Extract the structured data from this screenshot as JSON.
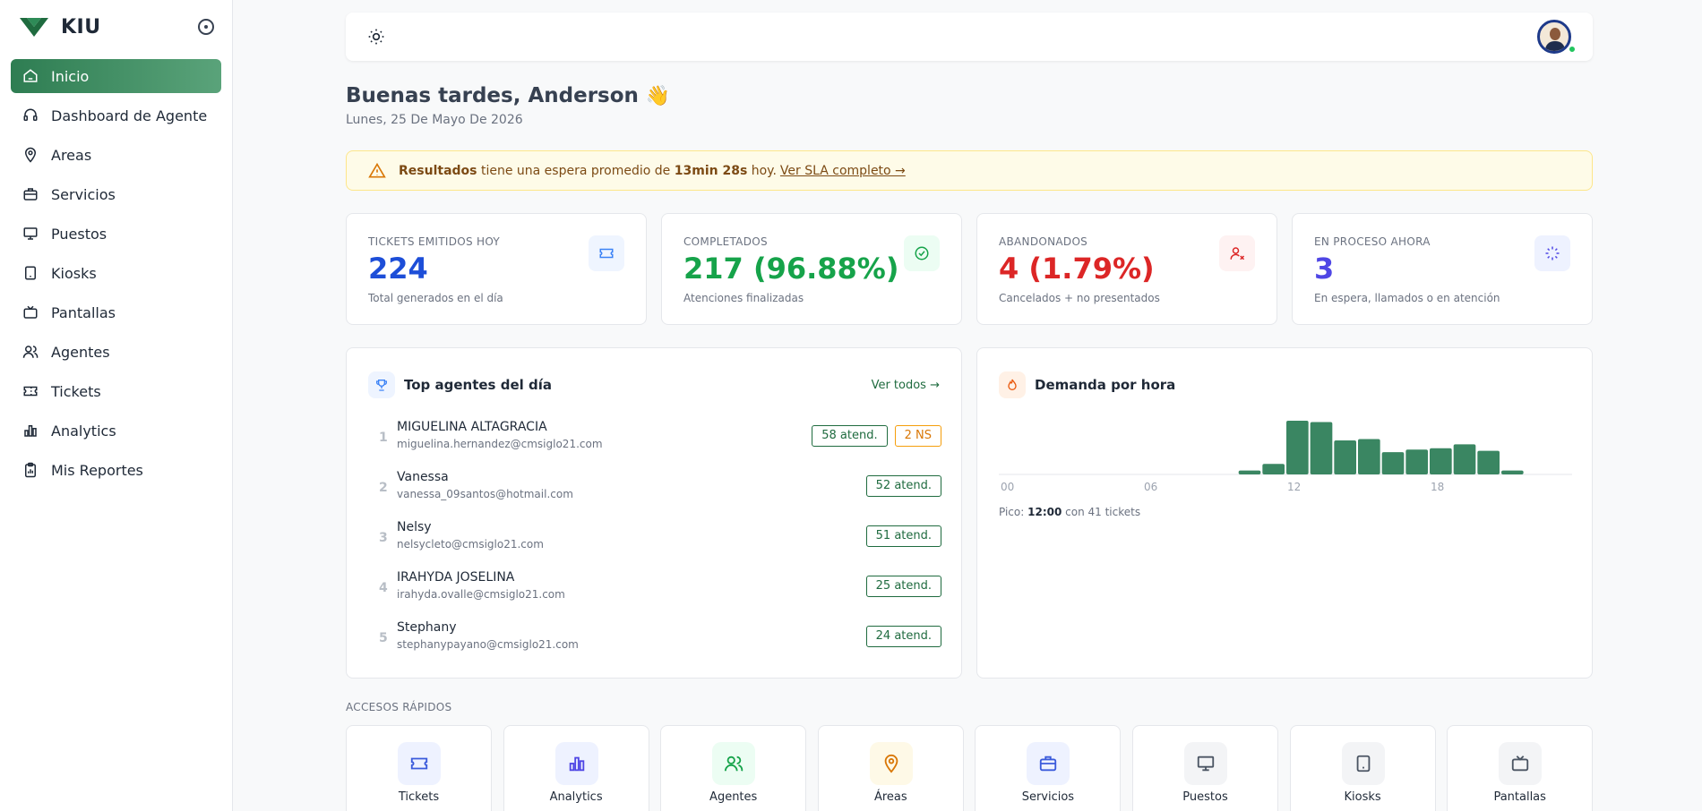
{
  "brand": {
    "name": "KIU"
  },
  "sidebar": {
    "items": [
      {
        "label": "Inicio",
        "icon": "home-icon",
        "active": true
      },
      {
        "label": "Dashboard de Agente",
        "icon": "headset-icon"
      },
      {
        "label": "Areas",
        "icon": "map-pin-icon"
      },
      {
        "label": "Servicios",
        "icon": "briefcase-icon"
      },
      {
        "label": "Puestos",
        "icon": "monitor-icon"
      },
      {
        "label": "Kiosks",
        "icon": "tablet-icon"
      },
      {
        "label": "Pantallas",
        "icon": "tv-icon"
      },
      {
        "label": "Agentes",
        "icon": "users-icon"
      },
      {
        "label": "Tickets",
        "icon": "ticket-icon"
      },
      {
        "label": "Analytics",
        "icon": "bar-chart-icon"
      },
      {
        "label": "Mis Reportes",
        "icon": "clipboard-icon"
      }
    ]
  },
  "header": {
    "greeting": "Buenas tardes, Anderson",
    "wave": "👋",
    "date": "Lunes, 25 De Mayo De 2026"
  },
  "alert": {
    "prefix": "Resultados",
    "middle": "tiene una espera promedio de",
    "time": "13min 28s",
    "suffix": "hoy.",
    "link": "Ver SLA completo →"
  },
  "stats": [
    {
      "label": "TICKETS EMITIDOS HOY",
      "value": "224",
      "sub": "Total generados en el día",
      "color": "#1d4ed8",
      "icon": "ticket-icon"
    },
    {
      "label": "COMPLETADOS",
      "value": "217 (96.88%)",
      "sub": "Atenciones finalizadas",
      "color": "#16a34a",
      "icon": "check-circle-icon"
    },
    {
      "label": "ABANDONADOS",
      "value": "4 (1.79%)",
      "sub": "Cancelados + no presentados",
      "color": "#dc2626",
      "icon": "user-x-icon"
    },
    {
      "label": "EN PROCESO AHORA",
      "value": "3",
      "sub": "En espera, llamados o en atención",
      "color": "#4f46e5",
      "icon": "loader-icon"
    }
  ],
  "top_agents": {
    "title": "Top agentes del día",
    "more": "Ver todos",
    "rows": [
      {
        "rank": "1",
        "name": "MIGUELINA ALTAGRACIA",
        "email": "miguelina.hernandez@cmsiglo21.com",
        "attended": "58 atend.",
        "ns": "2 NS"
      },
      {
        "rank": "2",
        "name": "Vanessa",
        "email": "vanessa_09santos@hotmail.com",
        "attended": "52 atend."
      },
      {
        "rank": "3",
        "name": "Nelsy",
        "email": "nelsycleto@cmsiglo21.com",
        "attended": "51 atend."
      },
      {
        "rank": "4",
        "name": "IRAHYDA JOSELINA",
        "email": "irahyda.ovalle@cmsiglo21.com",
        "attended": "25 atend."
      },
      {
        "rank": "5",
        "name": "Stephany",
        "email": "stephanypayano@cmsiglo21.com",
        "attended": "24 atend."
      }
    ]
  },
  "demand": {
    "title": "Demanda por hora",
    "peak_prefix": "Pico:",
    "peak_hour": "12:00",
    "peak_suffix": "con 41 tickets"
  },
  "chart_data": {
    "type": "bar",
    "categories": [
      "00",
      "01",
      "02",
      "03",
      "04",
      "05",
      "06",
      "07",
      "08",
      "09",
      "10",
      "11",
      "12",
      "13",
      "14",
      "15",
      "16",
      "17",
      "18",
      "19",
      "20",
      "21",
      "22",
      "23"
    ],
    "values": [
      0,
      0,
      0,
      0,
      0,
      0,
      0,
      0,
      0,
      0,
      3,
      8,
      41,
      40,
      26,
      27,
      17,
      19,
      20,
      23,
      18,
      3,
      0,
      0
    ],
    "tick_labels": [
      "00",
      "06",
      "12",
      "18"
    ],
    "title": "Demanda por hora",
    "xlabel": "",
    "ylabel": "",
    "ylim": [
      0,
      41
    ],
    "color": "#3a8662"
  },
  "quick_access": {
    "title": "ACCESOS RÁPIDOS",
    "items": [
      {
        "label": "Tickets",
        "icon": "ticket-icon",
        "bg": "#eef2ff",
        "fg": "#3b5bdb"
      },
      {
        "label": "Analytics",
        "icon": "bar-chart-icon",
        "bg": "#eef2ff",
        "fg": "#4f46e5"
      },
      {
        "label": "Agentes",
        "icon": "users-icon",
        "bg": "#ecfdf3",
        "fg": "#16a34a"
      },
      {
        "label": "Áreas",
        "icon": "map-pin-icon",
        "bg": "#fef9e7",
        "fg": "#d97706"
      },
      {
        "label": "Servicios",
        "icon": "briefcase-icon",
        "bg": "#eef2ff",
        "fg": "#3b5bdb"
      },
      {
        "label": "Puestos",
        "icon": "monitor-icon",
        "bg": "#f3f4f6",
        "fg": "#4b5563"
      },
      {
        "label": "Kiosks",
        "icon": "tablet-icon",
        "bg": "#f3f4f6",
        "fg": "#4b5563"
      },
      {
        "label": "Pantallas",
        "icon": "tv-icon",
        "bg": "#f3f4f6",
        "fg": "#4b5563"
      }
    ]
  }
}
